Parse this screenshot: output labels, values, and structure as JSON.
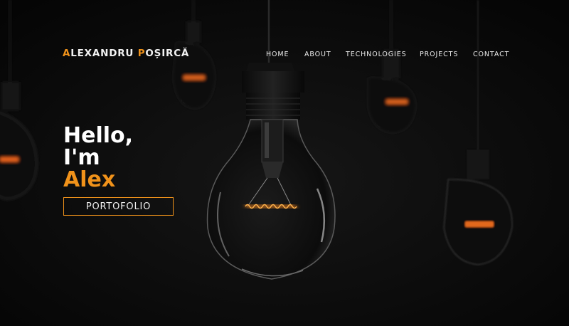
{
  "header": {
    "logo": {
      "first_initial": "A",
      "first_rest": "LEXANDRU ",
      "last_initial": "P",
      "last_rest": "OȘIRCĂ"
    },
    "nav": [
      "HOME",
      "ABOUT",
      "TECHNOLOGIES",
      "PROJECTS",
      "CONTACT"
    ]
  },
  "hero": {
    "greeting_line1": "Hello,",
    "greeting_line2": "I'm",
    "name": "Alex",
    "cta_label": "PORTOFOLIO"
  },
  "colors": {
    "accent": "#f0921a",
    "background": "#060606",
    "text": "#ffffff"
  }
}
